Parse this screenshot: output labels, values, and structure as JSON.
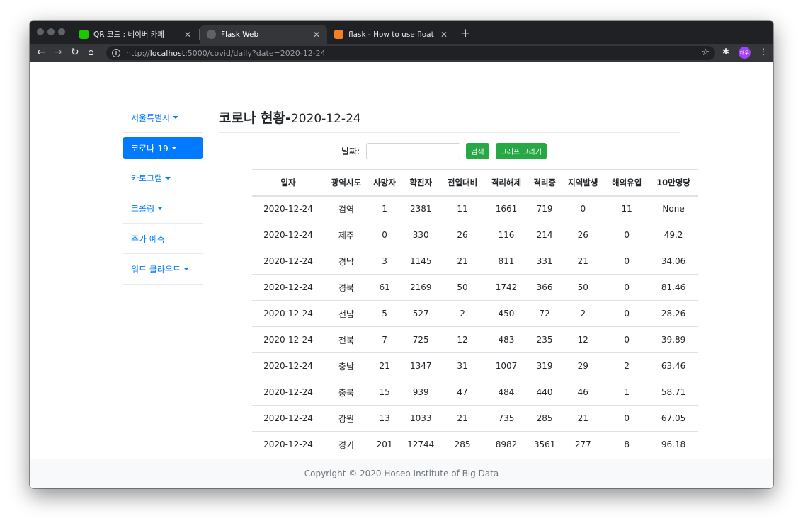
{
  "browser": {
    "tabs": [
      {
        "title": "QR 코드 : 네이버 카페",
        "favicon_color": "#1ec800"
      },
      {
        "title": "Flask Web",
        "favicon_color": "#5f6368"
      },
      {
        "title": "flask - How to use float filter to",
        "favicon_color": "#f48024"
      }
    ],
    "url_prefix": "http://",
    "url_host": "localhost",
    "url_rest": ":5000/covid/daily?date=2020-12-24",
    "avatar_text": "태우"
  },
  "sidebar": {
    "items": [
      {
        "label": "서울특별시",
        "dropdown": true
      },
      {
        "label": "코로나-19",
        "dropdown": true,
        "active": true
      },
      {
        "label": "카토그램",
        "dropdown": true
      },
      {
        "label": "크롤링",
        "dropdown": true
      },
      {
        "label": "주가 예측",
        "dropdown": false
      },
      {
        "label": "워드 클라우드",
        "dropdown": true
      }
    ]
  },
  "main": {
    "title": "코로나 현황-",
    "date": "2020-12-24",
    "search_label": "날짜:",
    "search_value": "",
    "search_button": "검색",
    "graph_button": "그래프 그리기"
  },
  "table": {
    "headers": [
      "일자",
      "광역시도",
      "사망자",
      "확진자",
      "전일대비",
      "격리해제",
      "격리중",
      "지역발생",
      "해외유입",
      "10만명당"
    ],
    "rows": [
      [
        "2020-12-24",
        "검역",
        "1",
        "2381",
        "11",
        "1661",
        "719",
        "0",
        "11",
        "None"
      ],
      [
        "2020-12-24",
        "제주",
        "0",
        "330",
        "26",
        "116",
        "214",
        "26",
        "0",
        "49.2"
      ],
      [
        "2020-12-24",
        "경남",
        "3",
        "1145",
        "21",
        "811",
        "331",
        "21",
        "0",
        "34.06"
      ],
      [
        "2020-12-24",
        "경북",
        "61",
        "2169",
        "50",
        "1742",
        "366",
        "50",
        "0",
        "81.46"
      ],
      [
        "2020-12-24",
        "전남",
        "5",
        "527",
        "2",
        "450",
        "72",
        "2",
        "0",
        "28.26"
      ],
      [
        "2020-12-24",
        "전북",
        "7",
        "725",
        "12",
        "483",
        "235",
        "12",
        "0",
        "39.89"
      ],
      [
        "2020-12-24",
        "충남",
        "21",
        "1347",
        "31",
        "1007",
        "319",
        "29",
        "2",
        "63.46"
      ],
      [
        "2020-12-24",
        "충북",
        "15",
        "939",
        "47",
        "484",
        "440",
        "46",
        "1",
        "58.71"
      ],
      [
        "2020-12-24",
        "강원",
        "13",
        "1033",
        "21",
        "735",
        "285",
        "21",
        "0",
        "67.05"
      ],
      [
        "2020-12-24",
        "경기",
        "201",
        "12744",
        "285",
        "8982",
        "3561",
        "277",
        "8",
        "96.18"
      ]
    ]
  },
  "footer": {
    "text": "Copyright © 2020 Hoseo Institute of Big Data"
  }
}
